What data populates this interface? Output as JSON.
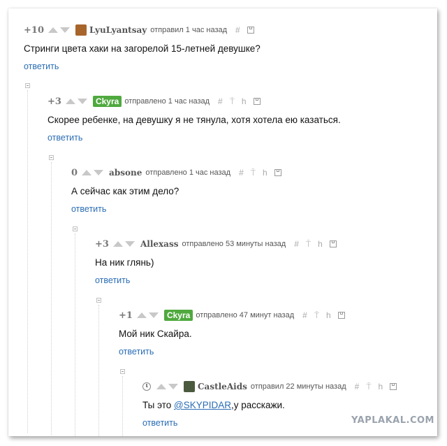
{
  "comments": [
    {
      "score": "+10",
      "author": "LyuLyantsay",
      "author_style": "plain-avatar",
      "meta": "отправил 1 час назад",
      "text": "Стринги цвета хаки на загорелой 15-летней девушке?",
      "reply": "ответить"
    },
    {
      "score": "+3",
      "author": "Ckyra",
      "author_style": "green-badge",
      "meta": "отправлено 1 час назад",
      "text": "Скорее ребенке, на девушку я не тянула, хотя хотела ею казаться.",
      "reply": "ответить"
    },
    {
      "score": "0",
      "author": "absone",
      "author_style": "plain",
      "meta": "отправлено 1 час назад",
      "text": "А сейчас как этим дело?",
      "reply": "ответить"
    },
    {
      "score": "+3",
      "author": "Allexass",
      "author_style": "plain",
      "meta": "отправлено 53 минуты назад",
      "text": "На ник глянь)",
      "reply": "ответить"
    },
    {
      "score": "+1",
      "author": "Ckyra",
      "author_style": "green-badge",
      "meta": "отправлено 47 минут назад",
      "text": "Мой ник Скайра.",
      "reply": "ответить"
    },
    {
      "score": "",
      "author": "CastleAids",
      "author_style": "plain-avatar",
      "meta": "отправил 22 минуты назад",
      "text_before": "Ты это ",
      "mention": "@SKYPIDAR",
      "text_after": ",у расскажи.",
      "reply": "ответить"
    }
  ],
  "icons": {
    "hash": "#",
    "up_tree": "⍑",
    "hierarchy": "h"
  },
  "watermark": "YAPLAKAL.COM",
  "colors": {
    "badge_green": "#4fa93e",
    "link_blue": "#2a6db5",
    "score_gray": "#777777"
  }
}
